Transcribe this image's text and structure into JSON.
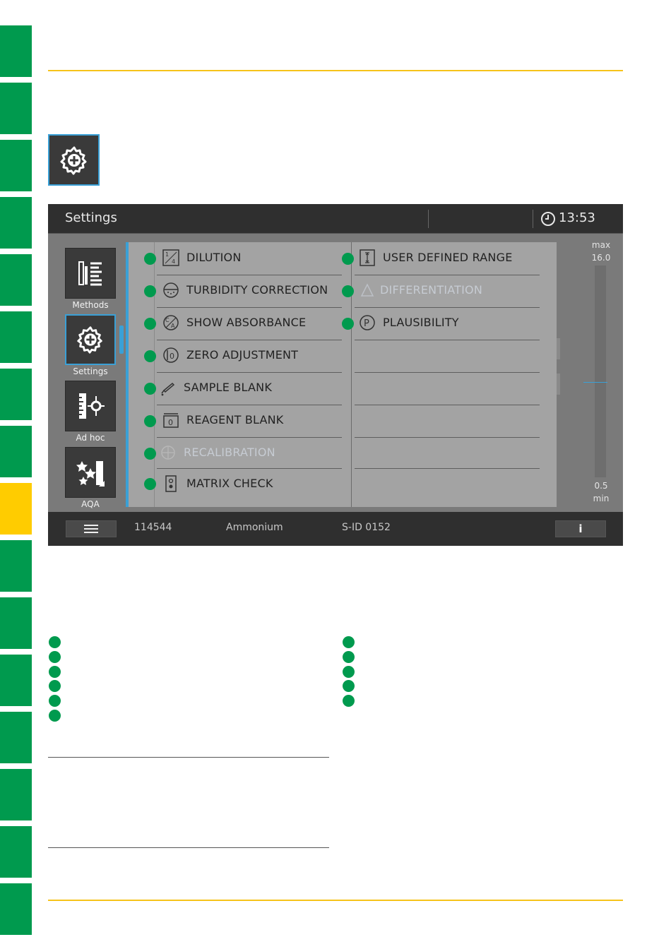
{
  "screen": {
    "title": "Settings",
    "time": "13:53",
    "sidebar": [
      {
        "label": "Methods",
        "icon": "methods-icon"
      },
      {
        "label": "Settings",
        "icon": "settings-gear-icon",
        "selected": true
      },
      {
        "label": "Ad hoc",
        "icon": "adhoc-icon"
      },
      {
        "label": "AQA",
        "icon": "aqa-stars-icon"
      }
    ],
    "left_menu": [
      {
        "label": "DILUTION",
        "icon": "dilution-icon",
        "enabled": true
      },
      {
        "label": "TURBIDITY CORRECTION",
        "icon": "turbidity-icon",
        "enabled": true
      },
      {
        "label": "SHOW ABSORBANCE",
        "icon": "absorbance-icon",
        "enabled": true
      },
      {
        "label": "ZERO ADJUSTMENT",
        "icon": "zero-adjustment-icon",
        "enabled": true
      },
      {
        "label": "SAMPLE BLANK",
        "icon": "sample-blank-icon",
        "enabled": true
      },
      {
        "label": "REAGENT BLANK",
        "icon": "reagent-blank-icon",
        "enabled": true
      },
      {
        "label": "RECALIBRATION",
        "icon": "recalibration-icon",
        "enabled": false
      },
      {
        "label": "MATRIX CHECK",
        "icon": "matrix-check-icon",
        "enabled": true
      }
    ],
    "right_menu": [
      {
        "label": "USER DEFINED RANGE",
        "icon": "user-range-icon",
        "enabled": true
      },
      {
        "label": "DIFFERENTIATION",
        "icon": "differentiation-icon",
        "enabled": false
      },
      {
        "label": "PLAUSIBILITY",
        "icon": "plausibility-icon",
        "enabled": true
      }
    ],
    "range": {
      "max_label": "max",
      "max_value": "16.0",
      "min_value": "0.5",
      "min_label": "min"
    },
    "statusbar": {
      "method_number": "114544",
      "parameter": "Ammonium",
      "sample_id": "S-ID 0152",
      "info_label": "i"
    }
  },
  "colors": {
    "green": "#009a4e",
    "yellow": "#ffcc00",
    "accent_blue": "#3aa0d6",
    "rule": "#f6c31a"
  }
}
